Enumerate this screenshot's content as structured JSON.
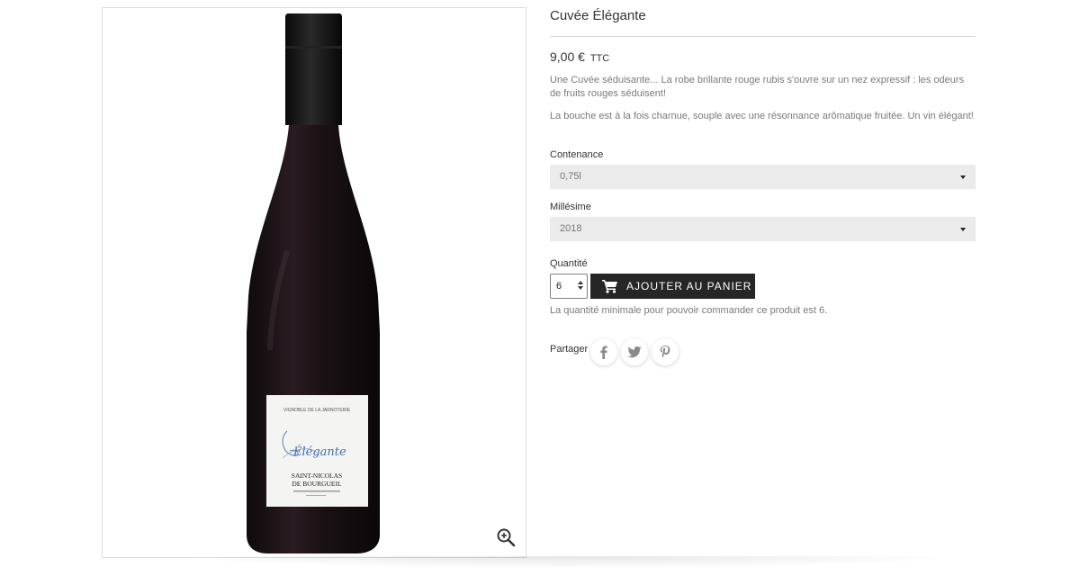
{
  "product": {
    "title": "Cuvée Élégante",
    "price": "9,00 €",
    "price_tax": "TTC",
    "description_1": "Une Cuvée séduisante... La robe brillante rouge rubis s'ouvre sur un nez expressif : les odeurs de fruits rouges séduisent!",
    "description_2": "La bouche est à la fois charnue, souple avec une résonnance arômatique fruitée. Un vin élégant!"
  },
  "label": {
    "vineyard": "VIGNOBLE DE LA JARNOTERIE",
    "cuvee": "Élégante",
    "appellation_1": "SAINT-NICOLAS",
    "appellation_2": "DE BOURGUEIL"
  },
  "options": {
    "contenance_label": "Contenance",
    "contenance_value": "0,75l",
    "millesime_label": "Millésime",
    "millesime_value": "2018"
  },
  "cart": {
    "quantity_label": "Quantité",
    "quantity_value": "6",
    "add_to_cart_label": "AJOUTER AU PANIER",
    "minimum_note": "La quantité minimale pour pouvoir commander ce produit est 6."
  },
  "share": {
    "label": "Partager",
    "icons": [
      "facebook-icon",
      "twitter-icon",
      "pinterest-icon"
    ]
  },
  "colors": {
    "button_bg": "#262626",
    "select_bg": "#ebebeb",
    "bottle": "#1a1216",
    "text_muted": "#7a7a7a"
  }
}
